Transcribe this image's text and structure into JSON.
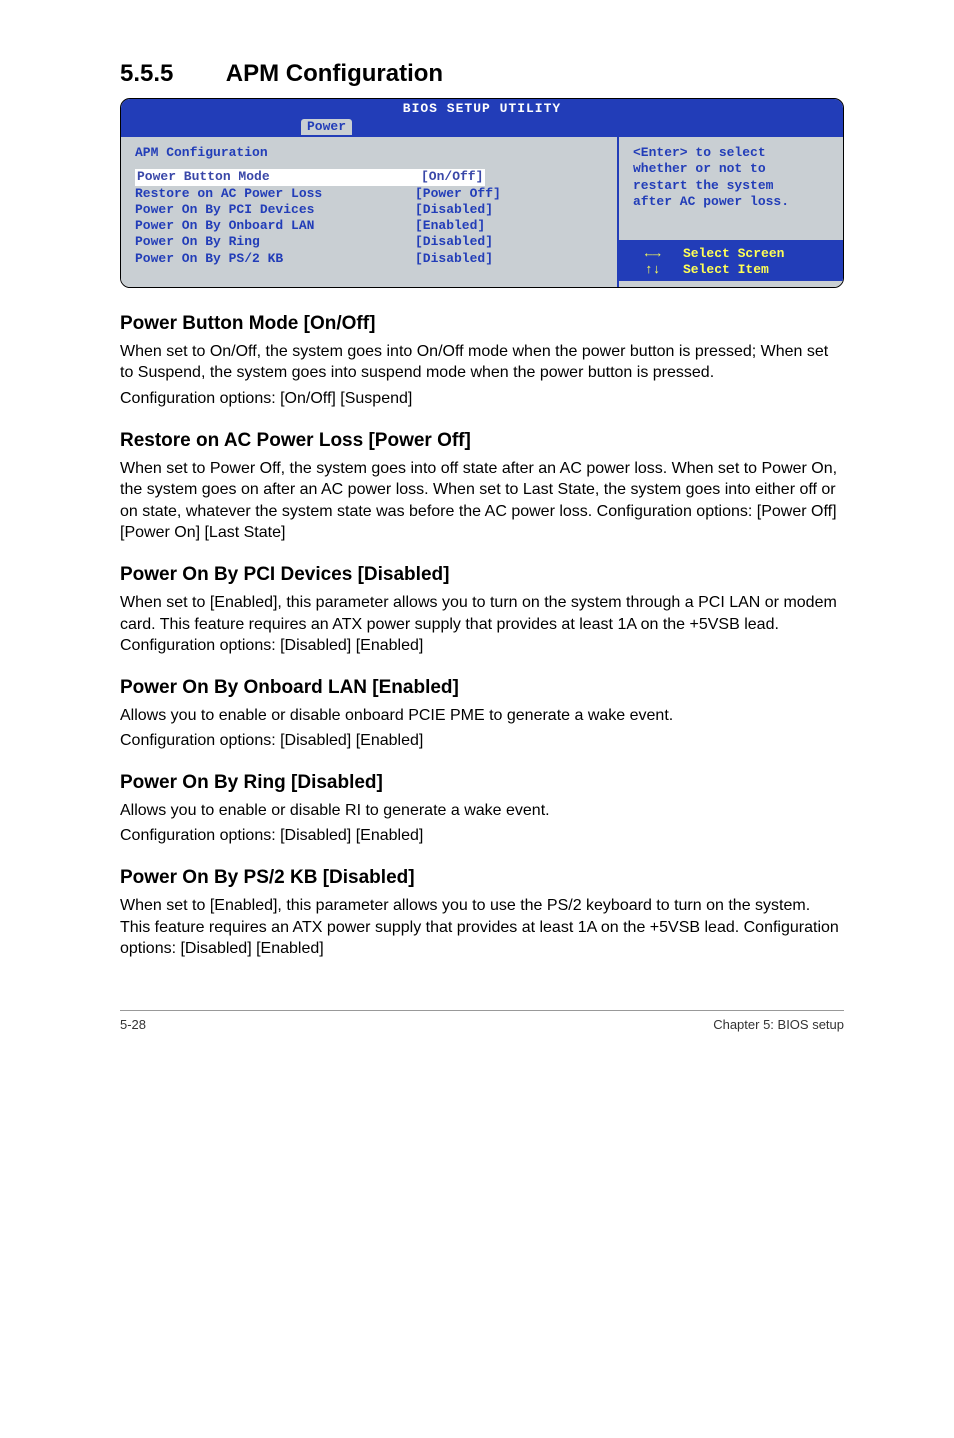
{
  "heading": {
    "number": "5.5.5",
    "title": "APM Configuration"
  },
  "bios": {
    "utility_title": "BIOS SETUP UTILITY",
    "tab": "Power",
    "panel_title": "APM Configuration",
    "rows": [
      {
        "label": "Power Button Mode",
        "value": "[On/Off]",
        "selected": true
      },
      {
        "label": "Restore on AC Power Loss",
        "value": "[Power Off]"
      },
      {
        "label": "",
        "value": ""
      },
      {
        "label": "Power On By PCI Devices",
        "value": "[Disabled]"
      },
      {
        "label": "Power On By Onboard LAN",
        "value": "[Enabled]"
      },
      {
        "label": "Power On By Ring",
        "value": "[Disabled]"
      },
      {
        "label": "Power On By PS/2 KB",
        "value": "[Disabled]"
      }
    ],
    "help": {
      "line1": "<Enter> to select",
      "line2": "whether or not to",
      "line3": "restart the system",
      "line4": "after AC power loss."
    },
    "keys": {
      "lr": "←→",
      "lr_label": "Select Screen",
      "ud": "↑↓",
      "ud_label": "Select Item"
    }
  },
  "options": [
    {
      "title": "Power Button Mode [On/Off]",
      "paras": [
        "When set to On/Off, the system goes into On/Off mode when the power button is pressed; When set to Suspend, the system goes into suspend mode when the power button is pressed.",
        "Configuration options: [On/Off] [Suspend]"
      ]
    },
    {
      "title": "Restore on AC Power Loss [Power Off]",
      "paras": [
        "When set to Power Off, the system goes into off state after an AC power loss. When set to Power On, the system goes on after an AC power loss. When set to Last State, the system goes into either off or on state, whatever the system state was before the AC power loss. Configuration options: [Power Off] [Power On] [Last State]"
      ]
    },
    {
      "title": "Power On By PCI Devices [Disabled]",
      "paras": [
        "When set to [Enabled], this parameter allows you to turn on the system through a PCI LAN or modem card. This feature requires an ATX power supply that provides at least 1A on the +5VSB lead. Configuration options: [Disabled] [Enabled]"
      ]
    },
    {
      "title": "Power On By Onboard LAN [Enabled]",
      "paras": [
        "Allows you to enable or disable onboard PCIE PME to generate a wake event.",
        "Configuration options: [Disabled] [Enabled]"
      ]
    },
    {
      "title": "Power On By Ring [Disabled]",
      "paras": [
        "Allows you to enable or disable RI to generate a wake event.",
        "Configuration options: [Disabled] [Enabled]"
      ]
    },
    {
      "title": "Power On By PS/2 KB [Disabled]",
      "paras": [
        "When set to [Enabled], this parameter allows you to use the PS/2 keyboard to turn on the system. This feature requires an ATX power supply that provides at least 1A on the +5VSB lead. Configuration options: [Disabled] [Enabled]"
      ]
    }
  ],
  "footer": {
    "left": "5-28",
    "right": "Chapter 5: BIOS setup"
  }
}
